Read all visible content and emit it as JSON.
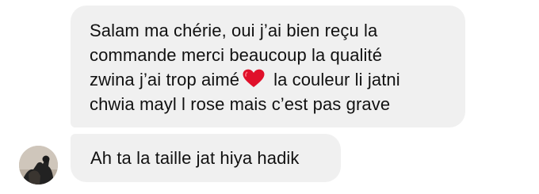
{
  "messages": [
    {
      "lines": [
        "Salam ma chérie, oui j’ai bien reçu la",
        "commande merci beaucoup la qualité",
        "zwina j’ai trop aimé",
        "la couleur li jatni",
        "chwia mayl l rose mais c’est pas grave"
      ],
      "emoji": "red-heart"
    },
    {
      "text": "Ah ta la taille jat hiya hadik"
    }
  ],
  "colors": {
    "bubble": "#f0f0f0",
    "text": "#111111",
    "heart": "#e0102a"
  },
  "avatar": {
    "icon": "profile-photo"
  }
}
